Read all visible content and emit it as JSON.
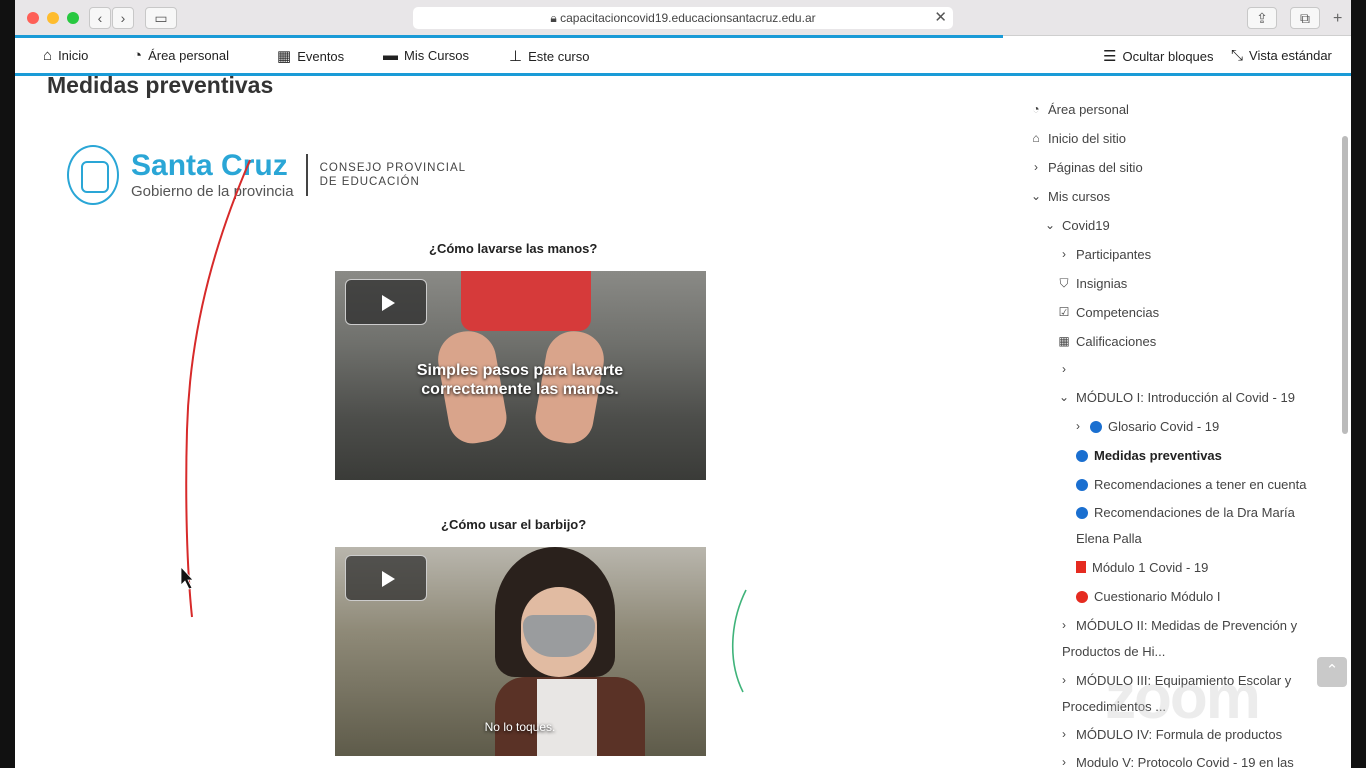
{
  "browser": {
    "url": "capacitacioncovid19.educacionsantacruz.edu.ar"
  },
  "navbar": {
    "home": "Inicio",
    "dashboard": "Área personal",
    "events": "Eventos",
    "my_courses": "Mis Cursos",
    "this_course": "Este curso",
    "hide_blocks": "Ocultar bloques",
    "standard_view": "Vista estándar"
  },
  "page": {
    "title": "Medidas preventivas"
  },
  "logo": {
    "title": "Santa Cruz",
    "subtitle": "Gobierno de la provincia",
    "right_line1": "CONSEJO PROVINCIAL",
    "right_line2": "DE EDUCACIÓN"
  },
  "videos": [
    {
      "title": "¿Cómo lavarse las manos?",
      "caption": "Simples pasos para lavarte correctamente las manos."
    },
    {
      "title": "¿Cómo usar el barbijo?",
      "caption": "No lo toques."
    }
  ],
  "sidebar": {
    "items": [
      {
        "label": "Área personal"
      },
      {
        "label": "Inicio del sitio"
      },
      {
        "label": "Páginas del sitio"
      },
      {
        "label": "Mis cursos"
      },
      {
        "label": "Covid19"
      },
      {
        "label": "Participantes"
      },
      {
        "label": "Insignias"
      },
      {
        "label": "Competencias"
      },
      {
        "label": "Calificaciones"
      },
      {
        "label": ""
      },
      {
        "label": "MÓDULO I: Introducción al Covid - 19"
      },
      {
        "label": "Glosario Covid - 19"
      },
      {
        "label": "Medidas preventivas"
      },
      {
        "label": "Recomendaciones a tener en cuenta"
      },
      {
        "label": "Recomendaciones de la Dra María"
      },
      {
        "label": "Elena Palla"
      },
      {
        "label": "Módulo 1 Covid - 19"
      },
      {
        "label": "Cuestionario Módulo I"
      },
      {
        "label": "MÓDULO II: Medidas de Prevención y"
      },
      {
        "label": "Productos de Hi..."
      },
      {
        "label": "MÓDULO III: Equipamiento Escolar y"
      },
      {
        "label": "Procedimientos ..."
      },
      {
        "label": "MÓDULO IV: Formula de productos"
      },
      {
        "label": "Modulo V: Protocolo Covid - 19 en las"
      }
    ]
  },
  "watermark": "zoom",
  "colors": {
    "accent": "#1a9bd7",
    "brand": "#2aa6d6",
    "status_blue": "#1a6fd0",
    "status_red": "#e52b20"
  }
}
